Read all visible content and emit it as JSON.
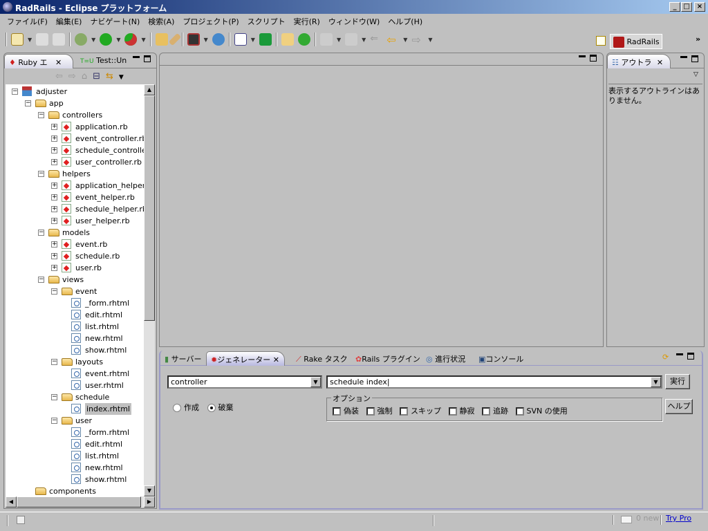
{
  "window": {
    "title": "RadRails - Eclipse プラットフォーム"
  },
  "menu": [
    "ファイル(F)",
    "編集(E)",
    "ナビゲート(N)",
    "検索(A)",
    "プロジェクト(P)",
    "スクリプト",
    "実行(R)",
    "ウィンドウ(W)",
    "ヘルプ(H)"
  ],
  "perspective": {
    "label": "RadRails",
    "more": "»"
  },
  "left_panel": {
    "tabs": [
      "Ruby エ",
      "Test::Un"
    ]
  },
  "tree": [
    {
      "level": 0,
      "type": "project",
      "label": "adjuster",
      "exp": "−"
    },
    {
      "level": 1,
      "type": "folder",
      "label": "app",
      "exp": "−"
    },
    {
      "level": 2,
      "type": "folder",
      "label": "controllers",
      "exp": "−"
    },
    {
      "level": 3,
      "type": "rb",
      "label": "application.rb",
      "exp": "+"
    },
    {
      "level": 3,
      "type": "rb",
      "label": "event_controller.rb",
      "exp": "+"
    },
    {
      "level": 3,
      "type": "rb",
      "label": "schedule_controller",
      "exp": "+"
    },
    {
      "level": 3,
      "type": "rb",
      "label": "user_controller.rb",
      "exp": "+"
    },
    {
      "level": 2,
      "type": "folder",
      "label": "helpers",
      "exp": "−"
    },
    {
      "level": 3,
      "type": "rb",
      "label": "application_helper.r",
      "exp": "+"
    },
    {
      "level": 3,
      "type": "rb",
      "label": "event_helper.rb",
      "exp": "+"
    },
    {
      "level": 3,
      "type": "rb",
      "label": "schedule_helper.rb",
      "exp": "+"
    },
    {
      "level": 3,
      "type": "rb",
      "label": "user_helper.rb",
      "exp": "+"
    },
    {
      "level": 2,
      "type": "folder",
      "label": "models",
      "exp": "−"
    },
    {
      "level": 3,
      "type": "rb",
      "label": "event.rb",
      "exp": "+"
    },
    {
      "level": 3,
      "type": "rb",
      "label": "schedule.rb",
      "exp": "+"
    },
    {
      "level": 3,
      "type": "rb",
      "label": "user.rb",
      "exp": "+"
    },
    {
      "level": 2,
      "type": "folder",
      "label": "views",
      "exp": "−"
    },
    {
      "level": 3,
      "type": "folder",
      "label": "event",
      "exp": "−"
    },
    {
      "level": 4,
      "type": "rhtml",
      "label": "_form.rhtml"
    },
    {
      "level": 4,
      "type": "rhtml",
      "label": "edit.rhtml"
    },
    {
      "level": 4,
      "type": "rhtml",
      "label": "list.rhtml"
    },
    {
      "level": 4,
      "type": "rhtml",
      "label": "new.rhtml"
    },
    {
      "level": 4,
      "type": "rhtml",
      "label": "show.rhtml"
    },
    {
      "level": 3,
      "type": "folder",
      "label": "layouts",
      "exp": "−"
    },
    {
      "level": 4,
      "type": "rhtml",
      "label": "event.rhtml"
    },
    {
      "level": 4,
      "type": "rhtml",
      "label": "user.rhtml"
    },
    {
      "level": 3,
      "type": "folder",
      "label": "schedule",
      "exp": "−"
    },
    {
      "level": 4,
      "type": "rhtml",
      "label": "index.rhtml",
      "selected": true
    },
    {
      "level": 3,
      "type": "folder",
      "label": "user",
      "exp": "−"
    },
    {
      "level": 4,
      "type": "rhtml",
      "label": "_form.rhtml"
    },
    {
      "level": 4,
      "type": "rhtml",
      "label": "edit.rhtml"
    },
    {
      "level": 4,
      "type": "rhtml",
      "label": "list.rhtml"
    },
    {
      "level": 4,
      "type": "rhtml",
      "label": "new.rhtml"
    },
    {
      "level": 4,
      "type": "rhtml",
      "label": "show.rhtml"
    },
    {
      "level": 1,
      "type": "folder",
      "label": "components"
    }
  ],
  "outline": {
    "tab": "アウトラ",
    "message": "表示するアウトラインはありません。"
  },
  "bottom": {
    "tabs": [
      "サーバー",
      "ジェネレーター",
      "Rake タスク",
      "Rails プラグイン",
      "進行状況",
      "コンソール"
    ],
    "generator": "controller",
    "params": "schedule index",
    "run": "実行",
    "help": "ヘルプ",
    "create": "作成",
    "destroy": "破棄",
    "options_title": "オプション",
    "options": [
      "偽装",
      "強制",
      "スキップ",
      "静寂",
      "追跡",
      "SVN の使用"
    ]
  },
  "status": {
    "mail": "0 new",
    "try_pro": "Try Pro"
  }
}
